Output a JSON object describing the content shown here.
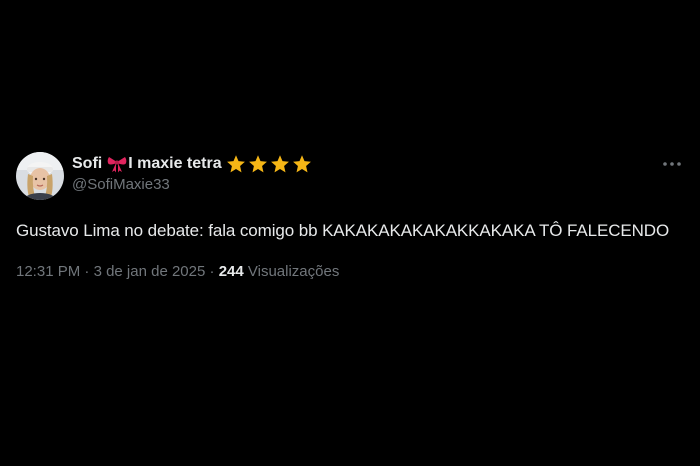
{
  "tweet": {
    "author": {
      "name": "Sofi",
      "name_suffix": "I maxie tetra",
      "handle": "@SofiMaxie33",
      "badge_icons": [
        "ribbon-bow-icon",
        "star-icon",
        "star-icon",
        "star-icon",
        "star-icon"
      ]
    },
    "text": "Gustavo Lima no debate: fala comigo bb KAKAKAKAKAKAKKAKAKA TÔ FALECENDO",
    "time": "12:31 PM",
    "separator": "·",
    "date": "3 de jan de 2025",
    "views_count": "244",
    "views_label": "Visualizações"
  },
  "colors": {
    "background": "#000000",
    "primary_text": "#e7e9ea",
    "secondary_text": "#71767b",
    "star": "#f5b616",
    "bow": "#e0245e"
  }
}
